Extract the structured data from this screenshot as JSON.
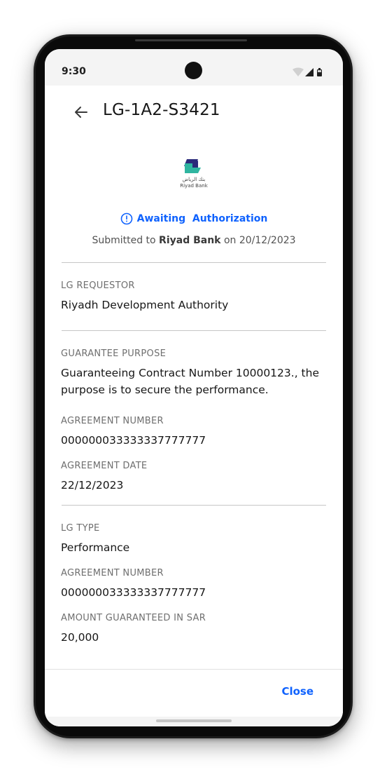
{
  "status_bar": {
    "time": "9:30"
  },
  "header": {
    "title": "LG-1A2-S3421",
    "back_icon": "arrow-left-icon"
  },
  "bank": {
    "logo_arabic": "بنك الرياض",
    "logo_english": "Riyad Bank",
    "logo_colors": {
      "navy": "#2b2a7a",
      "teal": "#2fb5a0"
    }
  },
  "status": {
    "icon": "alert-circle-icon",
    "text": "Awaiting  Authorization",
    "color": "#0f62fe"
  },
  "submission": {
    "prefix": "Submitted to ",
    "bank_name": "Riyad Bank",
    "middle": " on ",
    "date": "20/12/2023"
  },
  "sections": {
    "requestor": {
      "label": "LG REQUESTOR",
      "value": "Riyadh Development Authority"
    },
    "purpose": {
      "label": "GUARANTEE PURPOSE",
      "value": "Guaranteeing Contract Number 10000123., the purpose is to secure the performance.",
      "agreement_number_label": "AGREEMENT NUMBER",
      "agreement_number_value": "000000033333337777777",
      "agreement_date_label": "AGREEMENT DATE",
      "agreement_date_value": "22/12/2023"
    },
    "lg_type": {
      "label": "LG TYPE",
      "value": "Performance",
      "agreement_number_label": "AGREEMENT NUMBER",
      "agreement_number_value": "000000033333337777777",
      "amount_label": "AMOUNT GUARANTEED IN SAR",
      "amount_value": "20,000"
    }
  },
  "footer": {
    "close_label": "Close"
  }
}
